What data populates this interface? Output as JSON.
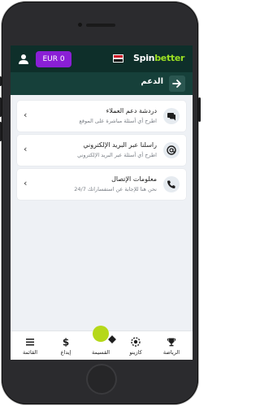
{
  "header": {
    "balance_label": "EUR 0",
    "logo_spin": "Spin",
    "logo_better": "better",
    "flag_colors": [
      "#ce1126",
      "#ffffff",
      "#000000"
    ]
  },
  "subheader": {
    "title": "الدعم"
  },
  "support_items": [
    {
      "title": "دردشة دعم العملاء",
      "subtitle": "اطرح أي أسئلة مباشرة على الموقع",
      "icon": "chat-icon"
    },
    {
      "title": "راسلنا عبر البريد الإلكتروني",
      "subtitle": "اطرح أي أسئلة عبر البريد الإلكتروني",
      "icon": "at-icon"
    },
    {
      "title": "معلومات الإتصال",
      "subtitle": "نحن هنا للإجابة عن استفساراتك 24/7",
      "icon": "phone-icon"
    }
  ],
  "bottom_nav": [
    {
      "label": "القائمة",
      "icon": "menu-icon"
    },
    {
      "label": "إيداع",
      "icon": "dollar-icon"
    },
    {
      "label": "القسيمة",
      "icon": "coupon-icon"
    },
    {
      "label": "كازينو",
      "icon": "casino-chip-icon"
    },
    {
      "label": "الرياضة",
      "icon": "trophy-icon"
    }
  ],
  "colors": {
    "topbar": "#0e2f2a",
    "subbar": "#16403a",
    "balance": "#8a1fd6",
    "accent": "#b5d819"
  }
}
